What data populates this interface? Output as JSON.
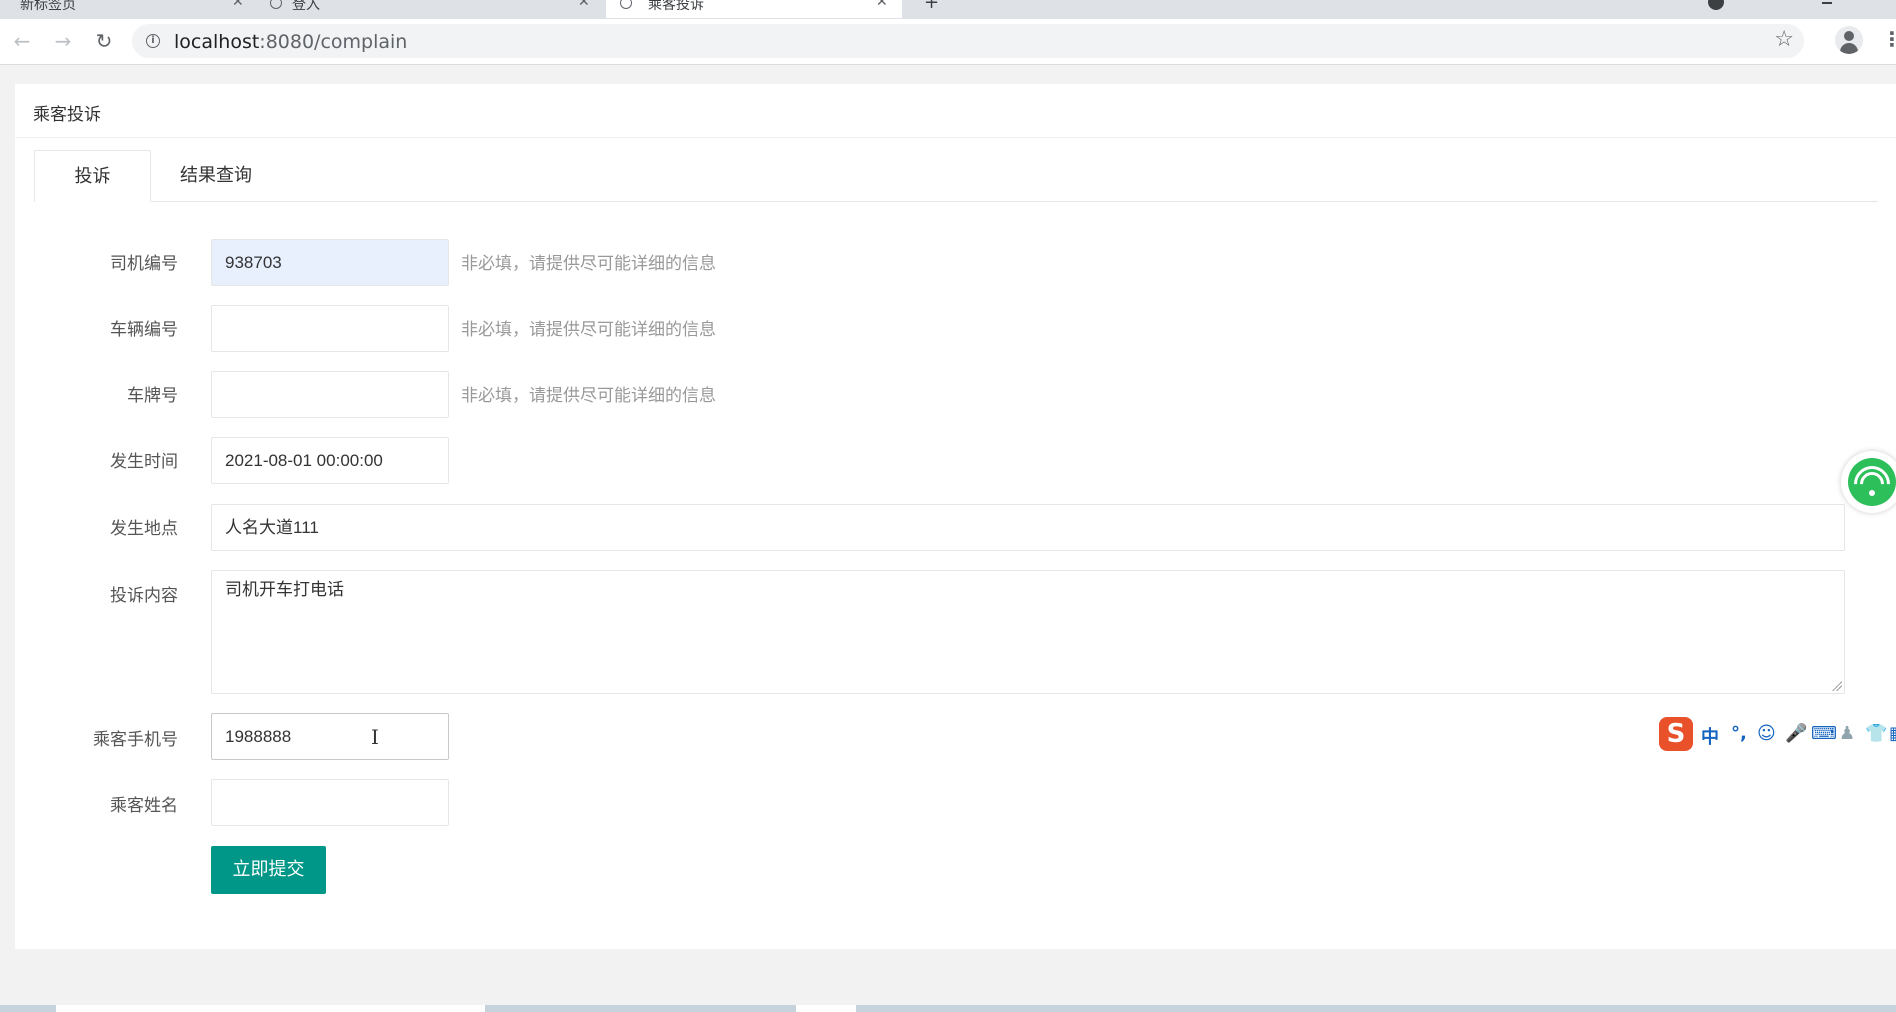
{
  "browser": {
    "tabs": [
      {
        "title": "新标签页",
        "active": false
      },
      {
        "title": "登入",
        "active": false
      },
      {
        "title": "乘客投诉",
        "active": true
      }
    ],
    "new_tab_symbol": "+",
    "url_host": "localhost",
    "url_rest": ":8080/complain",
    "icons": [
      "back-arrow",
      "forward-arrow",
      "reload",
      "info-circle",
      "star",
      "profile",
      "kebab-menu"
    ]
  },
  "page": {
    "title": "乘客投诉",
    "tabs": [
      {
        "label": "投诉",
        "active": true
      },
      {
        "label": "结果查询",
        "active": false
      }
    ]
  },
  "form": {
    "driver_id": {
      "label": "司机编号",
      "value": "938703",
      "hint": "非必填，请提供尽可能详细的信息"
    },
    "vehicle_id": {
      "label": "车辆编号",
      "value": "",
      "hint": "非必填，请提供尽可能详细的信息"
    },
    "plate": {
      "label": "车牌号",
      "value": "",
      "hint": "非必填，请提供尽可能详细的信息"
    },
    "time": {
      "label": "发生时间",
      "value": "2021-08-01 00:00:00"
    },
    "location": {
      "label": "发生地点",
      "value": "人名大道111"
    },
    "content": {
      "label": "投诉内容",
      "value": "司机开车打电话"
    },
    "phone": {
      "label": "乘客手机号",
      "value": "1988888"
    },
    "name": {
      "label": "乘客姓名",
      "value": ""
    },
    "submit_label": "立即提交"
  },
  "ime": {
    "logo": "S",
    "mode": "中",
    "punct": "°,",
    "icons": [
      "emoji-icon",
      "microphone-icon",
      "keyboard-icon",
      "user-icon",
      "shirt-icon",
      "grid-icon"
    ]
  },
  "colors": {
    "submit": "#009688",
    "autofill": "#e8f0fe",
    "wifi": "#2dbf5a",
    "ime_logo": "#e8512a"
  }
}
